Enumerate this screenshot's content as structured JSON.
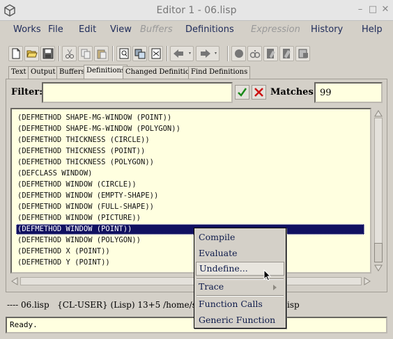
{
  "window": {
    "title": "Editor 1 - 06.lisp",
    "controls": [
      "–",
      "□",
      "✕"
    ]
  },
  "menu": [
    {
      "label": "Works",
      "disabled": false
    },
    {
      "label": "File",
      "disabled": false
    },
    {
      "label": "Edit",
      "disabled": false
    },
    {
      "label": "View",
      "disabled": false
    },
    {
      "label": "Buffers",
      "disabled": true
    },
    {
      "label": "Definitions",
      "disabled": false
    },
    {
      "label": "Expression",
      "disabled": true
    },
    {
      "label": "History",
      "disabled": false
    },
    {
      "label": "Help",
      "disabled": false
    }
  ],
  "toolbar": [
    "new-file-icon",
    "open-file-icon",
    "save-icon",
    "cut-icon",
    "copy-icon",
    "paste-icon",
    "find-icon",
    "replace-icon",
    "goto-icon",
    "back-icon",
    "forward-icon",
    "stop-icon",
    "inspect-icon",
    "compile-icon",
    "compile-buffer-icon",
    "lock-icon"
  ],
  "tabs": [
    {
      "label": "Text",
      "active": false
    },
    {
      "label": "Output",
      "active": false
    },
    {
      "label": "Buffers",
      "active": false
    },
    {
      "label": "Definitions",
      "active": true
    },
    {
      "label": "Changed Definitions",
      "active": false
    },
    {
      "label": "Find Definitions",
      "active": false
    }
  ],
  "filter": {
    "label": "Filter:",
    "value": "",
    "matches_label": "Matches:",
    "matches_value": "99"
  },
  "definitions": [
    {
      "text": "(DEFMETHOD SHAPE-MG-WINDOW (POINT))",
      "selected": false
    },
    {
      "text": "(DEFMETHOD SHAPE-MG-WINDOW (POLYGON))",
      "selected": false
    },
    {
      "text": "(DEFMETHOD THICKNESS (CIRCLE))",
      "selected": false
    },
    {
      "text": "(DEFMETHOD THICKNESS (POINT))",
      "selected": false
    },
    {
      "text": "(DEFMETHOD THICKNESS (POLYGON))",
      "selected": false
    },
    {
      "text": "(DEFCLASS WINDOW)",
      "selected": false
    },
    {
      "text": "(DEFMETHOD WINDOW (CIRCLE))",
      "selected": false
    },
    {
      "text": "(DEFMETHOD WINDOW (EMPTY-SHAPE))",
      "selected": false
    },
    {
      "text": "(DEFMETHOD WINDOW (FULL-SHAPE))",
      "selected": false
    },
    {
      "text": "(DEFMETHOD WINDOW (PICTURE))",
      "selected": false
    },
    {
      "text": "(DEFMETHOD WINDOW (POINT))",
      "selected": true
    },
    {
      "text": "(DEFMETHOD WINDOW (POLYGON))",
      "selected": false
    },
    {
      "text": "(DEFMETHOD X (POINT))",
      "selected": false
    },
    {
      "text": "(DEFMETHOD Y (POINT))",
      "selected": false
    }
  ],
  "status_line": {
    "left": "---- 06.lisp   {CL-USER} (Lisp) 13+5 /home/s",
    "right": "isp"
  },
  "echo": "Ready.",
  "context_menu": {
    "items": [
      "Compile",
      "Evaluate",
      "Undefine...",
      "Trace",
      "Function Calls",
      "Generic Function"
    ],
    "hovered": "Undefine..."
  },
  "colors": {
    "selection": "#101060",
    "field_bg": "#ffffe0",
    "ok_green": "#1a8a1a",
    "cancel_red": "#cc1010"
  }
}
